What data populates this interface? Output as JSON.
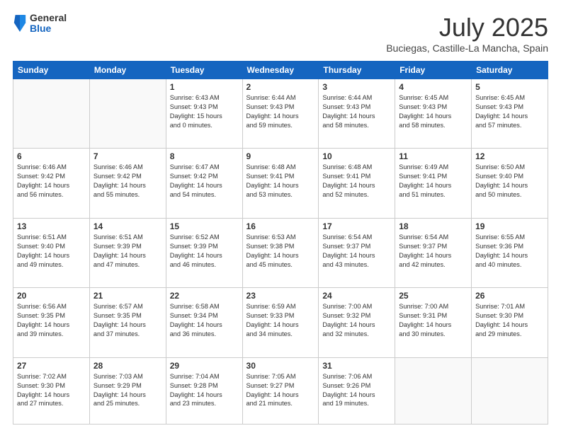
{
  "header": {
    "logo_general": "General",
    "logo_blue": "Blue",
    "month_title": "July 2025",
    "location": "Buciegas, Castille-La Mancha, Spain"
  },
  "days_of_week": [
    "Sunday",
    "Monday",
    "Tuesday",
    "Wednesday",
    "Thursday",
    "Friday",
    "Saturday"
  ],
  "weeks": [
    [
      {
        "day": "",
        "info": ""
      },
      {
        "day": "",
        "info": ""
      },
      {
        "day": "1",
        "info": "Sunrise: 6:43 AM\nSunset: 9:43 PM\nDaylight: 15 hours\nand 0 minutes."
      },
      {
        "day": "2",
        "info": "Sunrise: 6:44 AM\nSunset: 9:43 PM\nDaylight: 14 hours\nand 59 minutes."
      },
      {
        "day": "3",
        "info": "Sunrise: 6:44 AM\nSunset: 9:43 PM\nDaylight: 14 hours\nand 58 minutes."
      },
      {
        "day": "4",
        "info": "Sunrise: 6:45 AM\nSunset: 9:43 PM\nDaylight: 14 hours\nand 58 minutes."
      },
      {
        "day": "5",
        "info": "Sunrise: 6:45 AM\nSunset: 9:43 PM\nDaylight: 14 hours\nand 57 minutes."
      }
    ],
    [
      {
        "day": "6",
        "info": "Sunrise: 6:46 AM\nSunset: 9:42 PM\nDaylight: 14 hours\nand 56 minutes."
      },
      {
        "day": "7",
        "info": "Sunrise: 6:46 AM\nSunset: 9:42 PM\nDaylight: 14 hours\nand 55 minutes."
      },
      {
        "day": "8",
        "info": "Sunrise: 6:47 AM\nSunset: 9:42 PM\nDaylight: 14 hours\nand 54 minutes."
      },
      {
        "day": "9",
        "info": "Sunrise: 6:48 AM\nSunset: 9:41 PM\nDaylight: 14 hours\nand 53 minutes."
      },
      {
        "day": "10",
        "info": "Sunrise: 6:48 AM\nSunset: 9:41 PM\nDaylight: 14 hours\nand 52 minutes."
      },
      {
        "day": "11",
        "info": "Sunrise: 6:49 AM\nSunset: 9:41 PM\nDaylight: 14 hours\nand 51 minutes."
      },
      {
        "day": "12",
        "info": "Sunrise: 6:50 AM\nSunset: 9:40 PM\nDaylight: 14 hours\nand 50 minutes."
      }
    ],
    [
      {
        "day": "13",
        "info": "Sunrise: 6:51 AM\nSunset: 9:40 PM\nDaylight: 14 hours\nand 49 minutes."
      },
      {
        "day": "14",
        "info": "Sunrise: 6:51 AM\nSunset: 9:39 PM\nDaylight: 14 hours\nand 47 minutes."
      },
      {
        "day": "15",
        "info": "Sunrise: 6:52 AM\nSunset: 9:39 PM\nDaylight: 14 hours\nand 46 minutes."
      },
      {
        "day": "16",
        "info": "Sunrise: 6:53 AM\nSunset: 9:38 PM\nDaylight: 14 hours\nand 45 minutes."
      },
      {
        "day": "17",
        "info": "Sunrise: 6:54 AM\nSunset: 9:37 PM\nDaylight: 14 hours\nand 43 minutes."
      },
      {
        "day": "18",
        "info": "Sunrise: 6:54 AM\nSunset: 9:37 PM\nDaylight: 14 hours\nand 42 minutes."
      },
      {
        "day": "19",
        "info": "Sunrise: 6:55 AM\nSunset: 9:36 PM\nDaylight: 14 hours\nand 40 minutes."
      }
    ],
    [
      {
        "day": "20",
        "info": "Sunrise: 6:56 AM\nSunset: 9:35 PM\nDaylight: 14 hours\nand 39 minutes."
      },
      {
        "day": "21",
        "info": "Sunrise: 6:57 AM\nSunset: 9:35 PM\nDaylight: 14 hours\nand 37 minutes."
      },
      {
        "day": "22",
        "info": "Sunrise: 6:58 AM\nSunset: 9:34 PM\nDaylight: 14 hours\nand 36 minutes."
      },
      {
        "day": "23",
        "info": "Sunrise: 6:59 AM\nSunset: 9:33 PM\nDaylight: 14 hours\nand 34 minutes."
      },
      {
        "day": "24",
        "info": "Sunrise: 7:00 AM\nSunset: 9:32 PM\nDaylight: 14 hours\nand 32 minutes."
      },
      {
        "day": "25",
        "info": "Sunrise: 7:00 AM\nSunset: 9:31 PM\nDaylight: 14 hours\nand 30 minutes."
      },
      {
        "day": "26",
        "info": "Sunrise: 7:01 AM\nSunset: 9:30 PM\nDaylight: 14 hours\nand 29 minutes."
      }
    ],
    [
      {
        "day": "27",
        "info": "Sunrise: 7:02 AM\nSunset: 9:30 PM\nDaylight: 14 hours\nand 27 minutes."
      },
      {
        "day": "28",
        "info": "Sunrise: 7:03 AM\nSunset: 9:29 PM\nDaylight: 14 hours\nand 25 minutes."
      },
      {
        "day": "29",
        "info": "Sunrise: 7:04 AM\nSunset: 9:28 PM\nDaylight: 14 hours\nand 23 minutes."
      },
      {
        "day": "30",
        "info": "Sunrise: 7:05 AM\nSunset: 9:27 PM\nDaylight: 14 hours\nand 21 minutes."
      },
      {
        "day": "31",
        "info": "Sunrise: 7:06 AM\nSunset: 9:26 PM\nDaylight: 14 hours\nand 19 minutes."
      },
      {
        "day": "",
        "info": ""
      },
      {
        "day": "",
        "info": ""
      }
    ]
  ]
}
